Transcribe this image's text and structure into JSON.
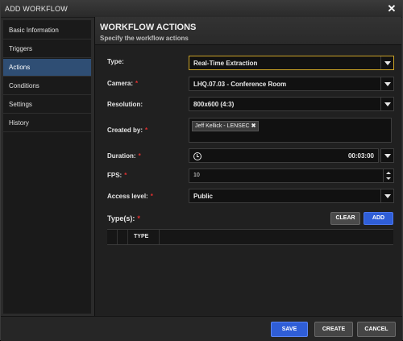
{
  "window": {
    "title": "ADD WORKFLOW",
    "close_icon": "close-icon"
  },
  "sidebar": {
    "items": [
      {
        "label": "Basic Information",
        "active": false
      },
      {
        "label": "Triggers",
        "active": false
      },
      {
        "label": "Actions",
        "active": true
      },
      {
        "label": "Conditions",
        "active": false
      },
      {
        "label": "Settings",
        "active": false
      },
      {
        "label": "History",
        "active": false
      }
    ]
  },
  "header": {
    "title": "WORKFLOW ACTIONS",
    "subtitle": "Specify the workflow actions"
  },
  "form": {
    "type": {
      "label": "Type:",
      "value": "Real-Time Extraction",
      "required": false
    },
    "camera": {
      "label": "Camera:",
      "value": "LHQ.07.03 - Conference Room",
      "required": true
    },
    "resolution": {
      "label": "Resolution:",
      "value": "800x600  (4:3)",
      "required": false
    },
    "created_by": {
      "label": "Created by:",
      "tag": "Jeff Kellick - LENSEC",
      "tag_remove": "✖",
      "required": true
    },
    "duration": {
      "label": "Duration:",
      "value": "00:03:00",
      "required": true
    },
    "fps": {
      "label": "FPS:",
      "value": "10",
      "required": true
    },
    "access_level": {
      "label": "Access level:",
      "value": "Public",
      "required": true
    },
    "types": {
      "label": "Type(s):",
      "required": true,
      "clear": "CLEAR",
      "add": "ADD",
      "column_header": "TYPE"
    },
    "required_mark": "*"
  },
  "footer": {
    "save": "SAVE",
    "create": "CREATE",
    "cancel": "CANCEL"
  },
  "colors": {
    "accent": "#2f5ed7",
    "active_nav": "#2f4e74",
    "required": "#e03030",
    "type_border": "#c9a227"
  }
}
